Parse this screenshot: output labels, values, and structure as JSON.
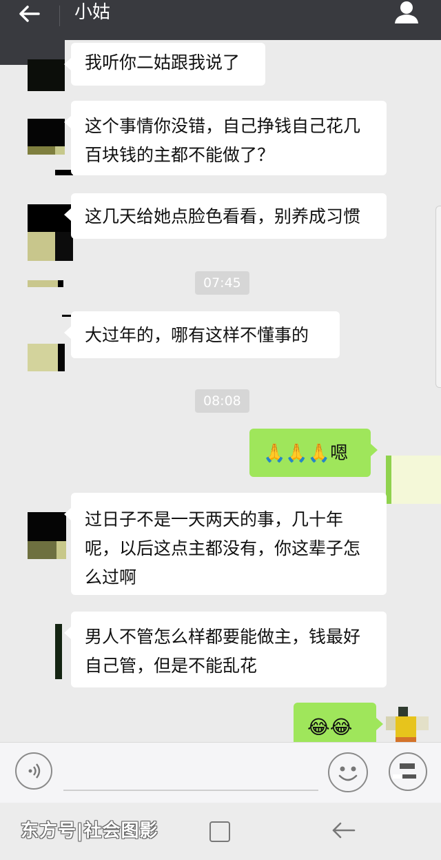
{
  "header": {
    "title": "小姑"
  },
  "messages": [
    {
      "side": "left",
      "text": "我听你二姑跟我说了"
    },
    {
      "side": "left",
      "text": "这个事情你没错，自己挣钱自己花几百块钱的主都不能做了？"
    },
    {
      "side": "left",
      "text": "这几天给她点脸色看看，别养成习惯"
    },
    {
      "side": "time",
      "text": "07:45"
    },
    {
      "side": "left",
      "text": "大过年的，哪有这样不懂事的"
    },
    {
      "side": "time",
      "text": "08:08"
    },
    {
      "side": "right",
      "text": "🙏🙏🙏嗯"
    },
    {
      "side": "left",
      "text": "过日子不是一天两天的事，几十年呢，以后这点主都没有，你这辈子怎么过啊"
    },
    {
      "side": "left",
      "text": "男人不管怎么样都要能做主，钱最好自己管，但是不能乱花"
    },
    {
      "side": "right",
      "text": "😂😂"
    }
  ],
  "footer": {
    "watermark": "东方号|社会图影"
  },
  "colors": {
    "header": "#393a3f",
    "chat_bg": "#ebebeb",
    "sent_bubble": "#9fe65b",
    "received_bubble": "#ffffff"
  },
  "icons": [
    "back-arrow-icon",
    "profile-icon",
    "voice-icon",
    "emoji-icon",
    "plus-icon",
    "nav-recent-icon",
    "nav-back-icon"
  ]
}
